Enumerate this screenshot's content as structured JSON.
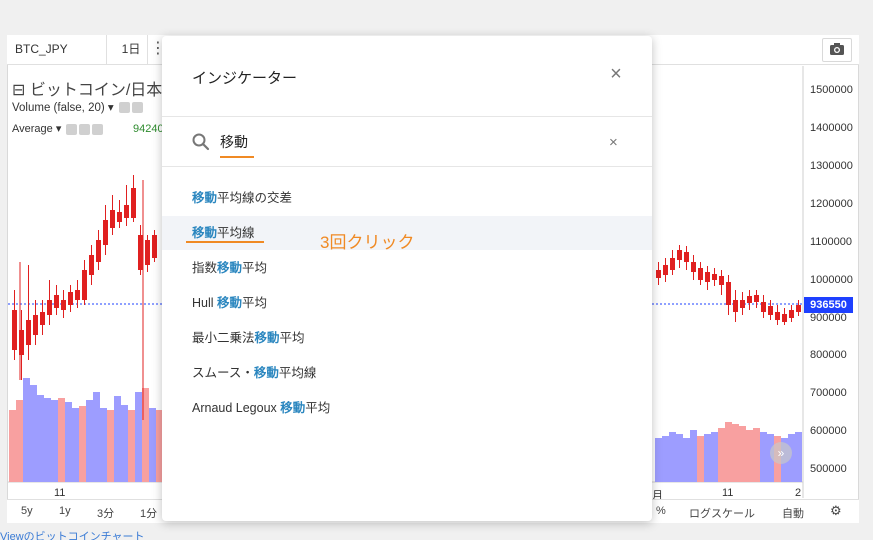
{
  "toolbar": {
    "symbol": "BTC_JPY",
    "interval": "1日",
    "indicators_icon": "indicators-icon",
    "camera_icon": "camera-icon"
  },
  "legend": {
    "title": "⊟ ビットコイン/日本",
    "volume": "Volume (false, 20) ▾",
    "average": "Average ▾",
    "average_value": "94240"
  },
  "price_axis": {
    "labels": [
      "1500000",
      "1400000",
      "1300000",
      "1200000",
      "1100000",
      "1000000",
      "900000",
      "800000",
      "700000",
      "600000",
      "500000"
    ],
    "last_price": "936550"
  },
  "time_axis": {
    "labels": [
      "11",
      "月",
      "11",
      "2"
    ]
  },
  "bottom_bar": {
    "ranges": [
      "5y",
      "1y",
      "3分",
      "1分"
    ],
    "percent": "%",
    "log_scale": "ログスケール",
    "auto": "自動",
    "settings_icon": "gear-icon"
  },
  "footer": {
    "link_text": "Viewのビットコインチャート"
  },
  "modal": {
    "title": "インジケーター",
    "search_value": "移動",
    "search_icon": "search-icon",
    "results": [
      {
        "highlight": "移動",
        "prefix": "",
        "suffix": "平均線の交差"
      },
      {
        "highlight": "移動",
        "prefix": "",
        "suffix": "平均線"
      },
      {
        "highlight": "移動",
        "prefix": "指数",
        "suffix": "平均"
      },
      {
        "highlight": "移動",
        "prefix": "Hull ",
        "suffix": "平均"
      },
      {
        "highlight": "移動",
        "prefix": "最小二乗法",
        "suffix": "平均"
      },
      {
        "highlight": "移動",
        "prefix": "スムース・",
        "suffix": "平均線"
      },
      {
        "highlight": "移動",
        "prefix": "Arnaud Legoux ",
        "suffix": "平均"
      }
    ]
  },
  "annotation": {
    "text": "3回クリック",
    "color": "#f08a24"
  },
  "colors": {
    "up": "#1e40ff",
    "down": "#e02020",
    "vol_up": "#9d9dff",
    "vol_down": "#f8a0a0",
    "highlight": "#2a86bf"
  }
}
